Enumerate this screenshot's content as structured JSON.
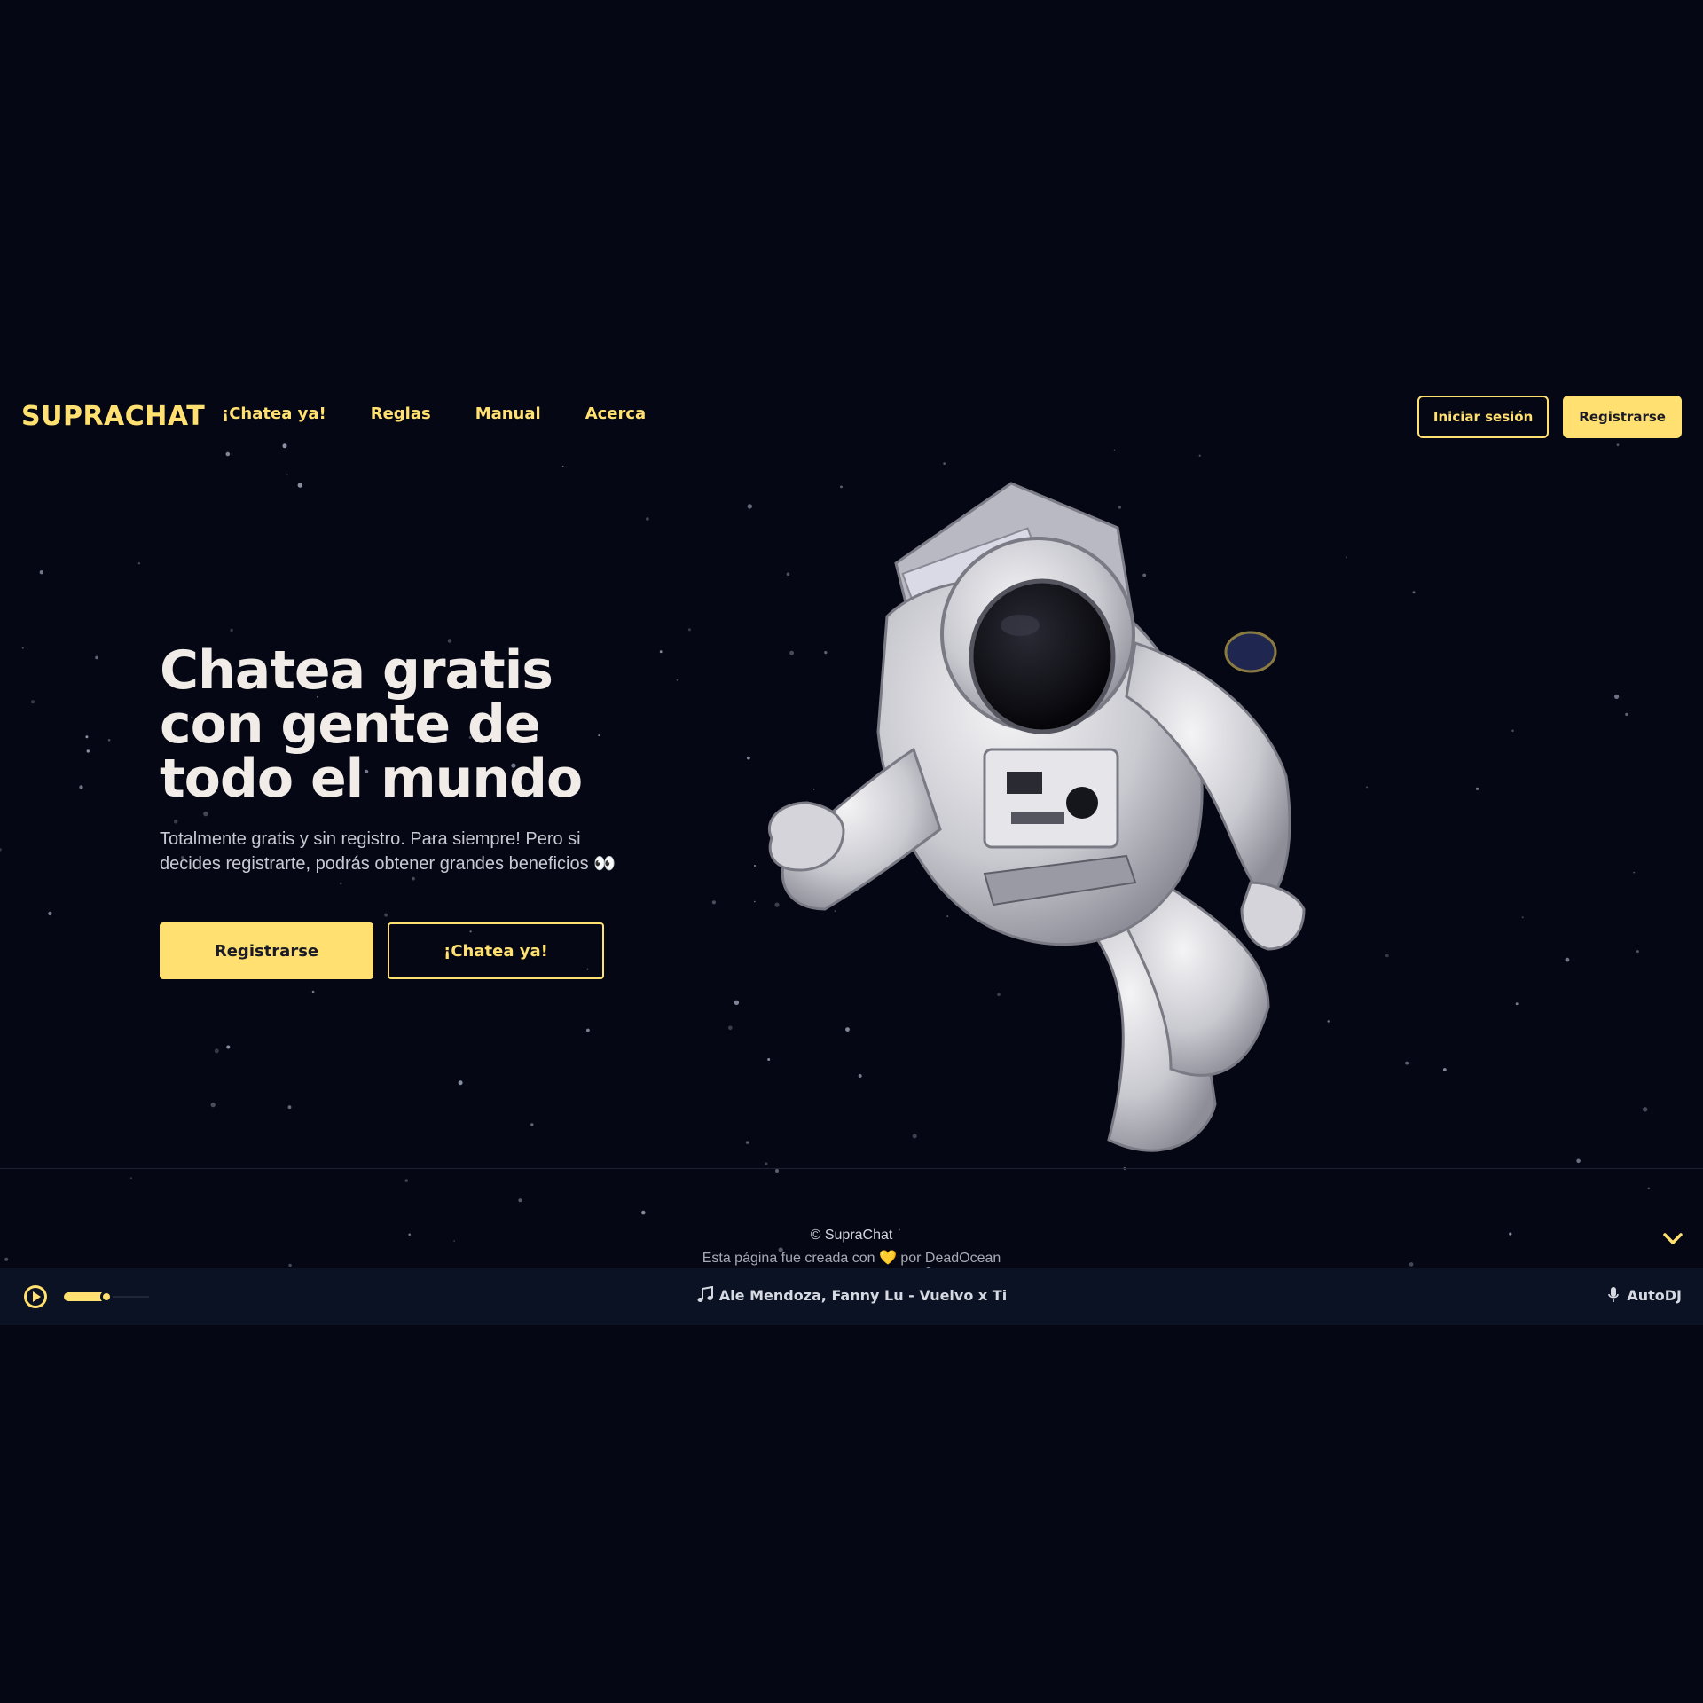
{
  "brand": {
    "logo": "SUPRACHAT"
  },
  "nav": {
    "links": [
      "¡Chatea ya!",
      "Reglas",
      "Manual",
      "Acerca"
    ],
    "login_label": "Iniciar sesión",
    "register_label": "Registrarse"
  },
  "hero": {
    "title": "Chatea gratis con gente de todo el mundo",
    "subtitle": "Totalmente gratis y sin registro. Para siempre! Pero si decides registrarte, podrás obtener grandes beneficios 👀",
    "primary_cta": "Registrarse",
    "secondary_cta": "¡Chatea ya!",
    "image_icon": "astronaut-illustration"
  },
  "footer": {
    "copyright": "© SupraChat",
    "credit": "Esta página fue creada con 💛 por DeadOcean",
    "scroll_icon": "chevron-down-icon"
  },
  "player": {
    "now_playing": "Ale Mendoza, Fanny Lu - Vuelvo x Ti",
    "dj_label": "AutoDJ",
    "volume_fraction": 0.5,
    "play_icon": "play-icon",
    "track_icon": "music-note-icon",
    "dj_icon": "microphone-icon"
  },
  "colors": {
    "background": "#050814",
    "accent": "#ffe070",
    "player_bar": "#0a1224"
  }
}
